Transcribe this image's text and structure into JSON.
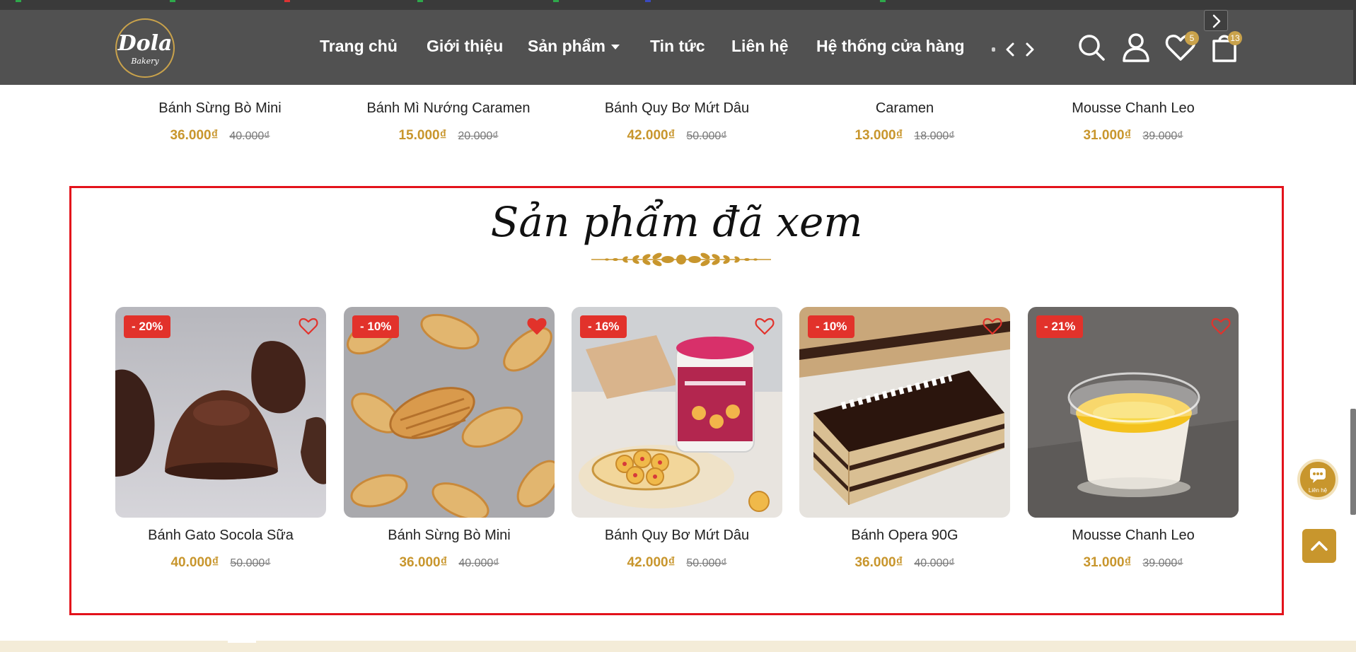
{
  "header": {
    "logo": {
      "name": "Dola",
      "sub": "Bakery"
    },
    "nav": [
      {
        "label": "Trang chủ"
      },
      {
        "label": "Giới thiệu"
      },
      {
        "label": "Sản phẩm",
        "has_dropdown": true
      },
      {
        "label": "Tin tức"
      },
      {
        "label": "Liên hệ"
      },
      {
        "label": "Hệ thống cửa hàng"
      }
    ],
    "wishlist_count": "5",
    "cart_count": "13",
    "icons": [
      "search-icon",
      "user-icon",
      "heart-icon",
      "cart-icon",
      "chevron-left-icon",
      "chevron-right-icon"
    ]
  },
  "top_row": [
    {
      "name": "Bánh Sừng Bò Mini",
      "price": "36.000₫",
      "old_price": "40.000₫"
    },
    {
      "name": "Bánh Mì Nướng Caramen",
      "price": "15.000₫",
      "old_price": "20.000₫"
    },
    {
      "name": "Bánh Quy Bơ Mứt Dâu",
      "price": "42.000₫",
      "old_price": "50.000₫"
    },
    {
      "name": "Caramen",
      "price": "13.000₫",
      "old_price": "18.000₫"
    },
    {
      "name": "Mousse Chanh Leo",
      "price": "31.000₫",
      "old_price": "39.000₫"
    }
  ],
  "viewed_section": {
    "title": "Sản phẩm đã xem",
    "products": [
      {
        "name": "Bánh Gato Socola Sữa",
        "discount": "- 20%",
        "price": "40.000₫",
        "old_price": "50.000₫",
        "favorited": false,
        "image": "chocolate-cake"
      },
      {
        "name": "Bánh Sừng Bò Mini",
        "discount": "- 10%",
        "price": "36.000₫",
        "old_price": "40.000₫",
        "favorited": true,
        "image": "mini-croissants"
      },
      {
        "name": "Bánh Quy Bơ Mứt Dâu",
        "discount": "- 16%",
        "price": "42.000₫",
        "old_price": "50.000₫",
        "favorited": false,
        "image": "butter-cookies-jar"
      },
      {
        "name": "Bánh Opera 90G",
        "discount": "- 10%",
        "price": "36.000₫",
        "old_price": "40.000₫",
        "favorited": false,
        "image": "opera-cake"
      },
      {
        "name": "Mousse Chanh Leo",
        "discount": "- 21%",
        "price": "31.000₫",
        "old_price": "39.000₫",
        "favorited": false,
        "image": "passionfruit-mousse"
      }
    ]
  },
  "floating": {
    "chat_label": "Liên hệ"
  },
  "colors": {
    "header_bg": "#515151",
    "accent_gold": "#c8962d",
    "discount_red": "#e2322b",
    "highlight_border": "#e3121b",
    "footer_bg": "#f4ecd8"
  }
}
